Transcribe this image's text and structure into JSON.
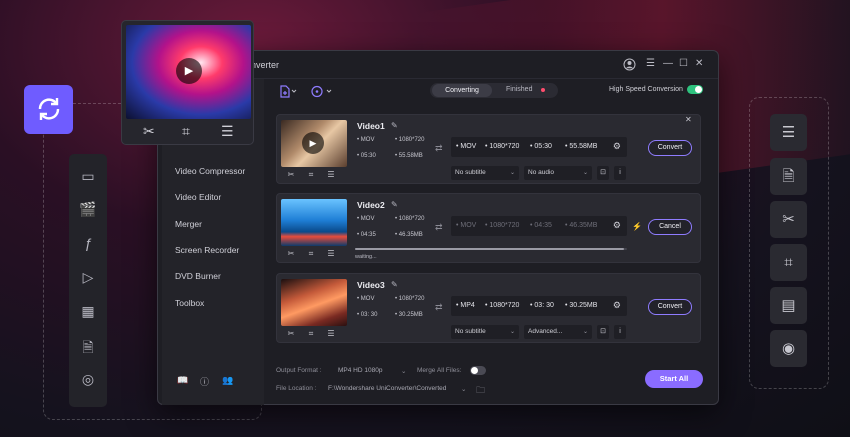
{
  "app": {
    "title": "nverter"
  },
  "tabs": {
    "converting": "Converting",
    "finished": "Finished"
  },
  "high_speed": {
    "label": "High Speed Conversion",
    "enabled": true
  },
  "sidebar": {
    "items": [
      {
        "label": "Video Compressor"
      },
      {
        "label": "Video Editor"
      },
      {
        "label": "Merger"
      },
      {
        "label": "Screen Recorder"
      },
      {
        "label": "DVD Burner"
      },
      {
        "label": "Toolbox"
      }
    ]
  },
  "videos": [
    {
      "name": "Video1",
      "src": {
        "format": "MOV",
        "resolution": "1080*720",
        "duration": "05:30",
        "size": "55.58MB"
      },
      "out": {
        "format": "MOV",
        "resolution": "1080*720",
        "duration": "05:30",
        "size": "55.58MB"
      },
      "subtitle": "No subtitle",
      "audio": "No audio",
      "action": "Convert"
    },
    {
      "name": "Video2",
      "src": {
        "format": "MOV",
        "resolution": "1080*720",
        "duration": "04:35",
        "size": "46.35MB"
      },
      "out": {
        "format": "MOV",
        "resolution": "1080*720",
        "duration": "04:35",
        "size": "46.35MB"
      },
      "status": "waiting...",
      "progress": 0.99,
      "action": "Cancel"
    },
    {
      "name": "Video3",
      "src": {
        "format": "MOV",
        "resolution": "1080*720",
        "duration": "03: 30",
        "size": "30.25MB"
      },
      "out": {
        "format": "MP4",
        "resolution": "1080*720",
        "duration": "03: 30",
        "size": "30.25MB"
      },
      "subtitle": "No subtitle",
      "audio": "Advanced...",
      "action": "Convert"
    }
  ],
  "footer": {
    "output_format_label": "Output Format :",
    "output_format_value": "MP4 HD 1080p",
    "merge_label": "Merge All Files:",
    "merge_enabled": false,
    "file_location_label": "File Location :",
    "file_location_value": "F:\\Wondershare UniConverter\\Converted",
    "start_all": "Start All"
  },
  "icons": {
    "refresh": "refresh-icon",
    "left_panel": [
      "video-icon",
      "clapper-icon",
      "script-icon",
      "screen-play-icon",
      "film-icon",
      "document-play-icon",
      "disc-icon"
    ],
    "right_panel": [
      "sliders-icon",
      "document-edit-icon",
      "scissors-icon",
      "crop-icon",
      "document-icon",
      "chart-icon"
    ]
  },
  "colors": {
    "accent": "#8a6cff",
    "toggle_on": "#2ec27e",
    "finished_dot": "#ff4d6d",
    "bolt": "#f4b400"
  }
}
